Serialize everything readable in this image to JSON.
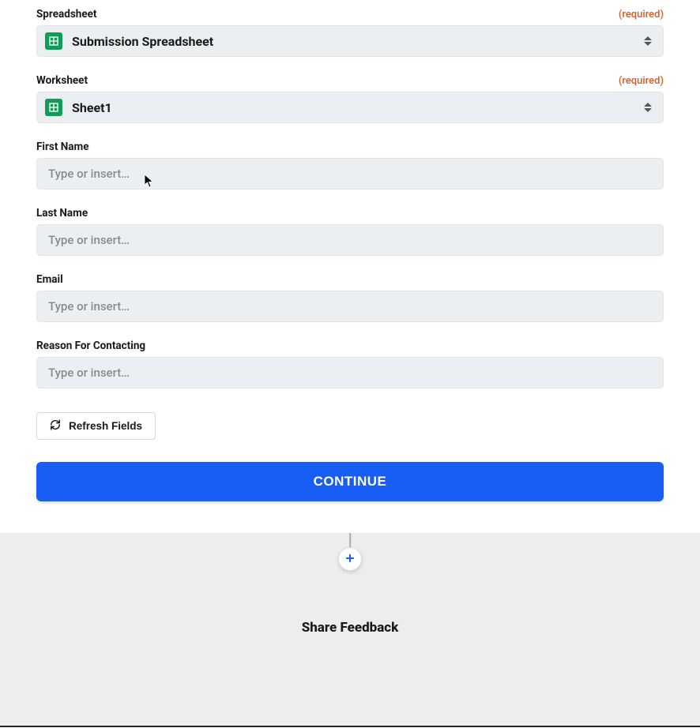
{
  "colors": {
    "primary": "#185ef5",
    "required": "#d95c28",
    "sheets": "#0f9d58"
  },
  "fields": {
    "spreadsheet": {
      "label": "Spreadsheet",
      "required_text": "(required)",
      "value": "Submission Spreadsheet"
    },
    "worksheet": {
      "label": "Worksheet",
      "required_text": "(required)",
      "value": "Sheet1"
    },
    "first_name": {
      "label": "First Name",
      "placeholder": "Type or insert…"
    },
    "last_name": {
      "label": "Last Name",
      "placeholder": "Type or insert…"
    },
    "email": {
      "label": "Email",
      "placeholder": "Type or insert…"
    },
    "reason": {
      "label": "Reason For Contacting",
      "placeholder": "Type or insert…"
    }
  },
  "actions": {
    "refresh": "Refresh Fields",
    "continue": "CONTINUE"
  },
  "footer": {
    "share": "Share Feedback"
  }
}
